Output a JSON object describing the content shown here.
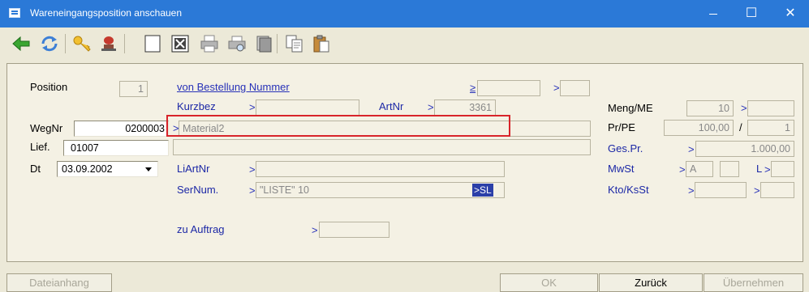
{
  "window": {
    "title": "Wareneingangsposition anschauen",
    "maximize": "☐",
    "close": "✕"
  },
  "toolbar": {
    "icons": [
      "back-arrow-icon",
      "refresh-icon",
      "key-icon",
      "stamp-icon",
      "blank-page-icon",
      "cross-box-icon",
      "print-icon",
      "print-preview-icon",
      "stack-icon",
      "copy-icon",
      "paste-icon"
    ]
  },
  "form": {
    "position_label": "Position",
    "position_value": "1",
    "von_bestellung_label": "von Bestellung Nummer",
    "von_bestellung_ge": "≥",
    "von_bestellung_gt": ">",
    "kurzbez_label": "Kurzbez",
    "kurzbez_arrow": ">",
    "artnr_label": "ArtNr",
    "artnr_arrow": ">",
    "artnr_value": "3361",
    "meng_label": "Meng/ME",
    "meng_value": "10",
    "meng_arrow": ">",
    "wegnr_label": "WegNr",
    "wegnr_value": "0200003",
    "material_arrow": ">",
    "material_value": "Material2",
    "prpe_label": "Pr/PE",
    "prpe_value": "100,00",
    "prpe_slash": "/",
    "prpe_unit": "1",
    "lief_label": "Lief.",
    "lief_value": "01007",
    "gespr_label": "Ges.Pr.",
    "gespr_arrow": ">",
    "gespr_value": "1.000,00",
    "dt_label": "Dt",
    "dt_value": "03.09.2002",
    "liartnr_label": "LiArtNr",
    "liartnr_arrow": ">",
    "mwst_label": "MwSt",
    "mwst_arrow": ">",
    "mwst_value": "A",
    "l_label": "L",
    "l_arrow": ">",
    "sernum_label": "SerNum.",
    "sernum_arrow": ">",
    "sernum_value": "\"LISTE\" 10",
    "sernum_selected": ">SL",
    "kto_label": "Kto/KsSt",
    "kto_arrow": ">",
    "kto_arrow2": ">",
    "zu_auftrag_label": "zu Auftrag",
    "zu_auftrag_arrow": ">"
  },
  "buttons": {
    "dateianhang": "Dateianhang",
    "ok": "OK",
    "zurueck": "Zurück",
    "uebernehmen": "Übernehmen"
  },
  "colors": {
    "titlebar": "#2b79d7",
    "label_blue": "#1c28a6",
    "highlight": "#d8242a",
    "selection": "#2b3fa8"
  }
}
